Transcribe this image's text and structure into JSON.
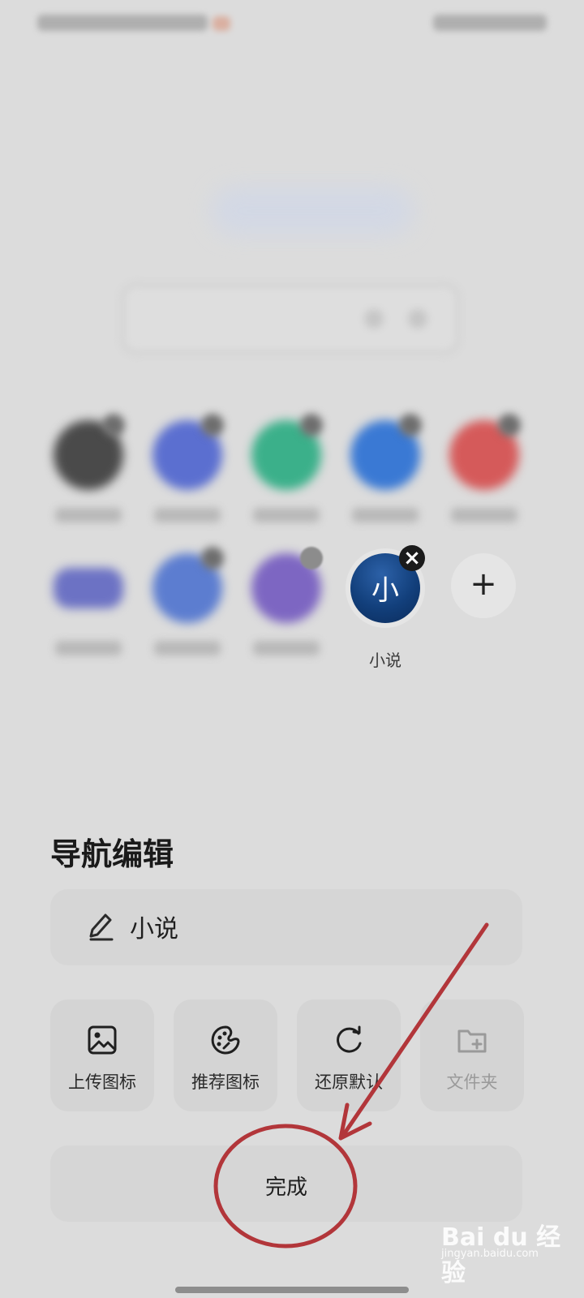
{
  "nav": {
    "items": [
      {
        "label": "",
        "color": "#4a4a4a"
      },
      {
        "label": "",
        "color": "#5b6fd0"
      },
      {
        "label": "",
        "color": "#3bb08a"
      },
      {
        "label": "",
        "color": "#3a79d4"
      },
      {
        "label": "",
        "color": "#d55a5a"
      },
      {
        "label": "",
        "color": "#6c72c4"
      },
      {
        "label": "",
        "color": "#5c7dd0"
      },
      {
        "label": "",
        "color": "#7d66c2"
      }
    ],
    "selected": {
      "icon_text": "小",
      "label": "小说",
      "remove_symbol": "×"
    },
    "add_symbol": "+"
  },
  "sheet": {
    "title": "导航编辑",
    "name_value": "小说",
    "actions": [
      {
        "label": "上传图标",
        "icon": "image-icon"
      },
      {
        "label": "推荐图标",
        "icon": "palette-icon"
      },
      {
        "label": "还原默认",
        "icon": "refresh-icon"
      },
      {
        "label": "文件夹",
        "icon": "folder-plus-icon",
        "disabled": true
      }
    ],
    "done_label": "完成"
  },
  "watermark": {
    "main": "Bai du 经验",
    "sub": "jingyan.baidu.com"
  },
  "colors": {
    "annotation": "#b2363a",
    "background": "#dcdcdc"
  }
}
